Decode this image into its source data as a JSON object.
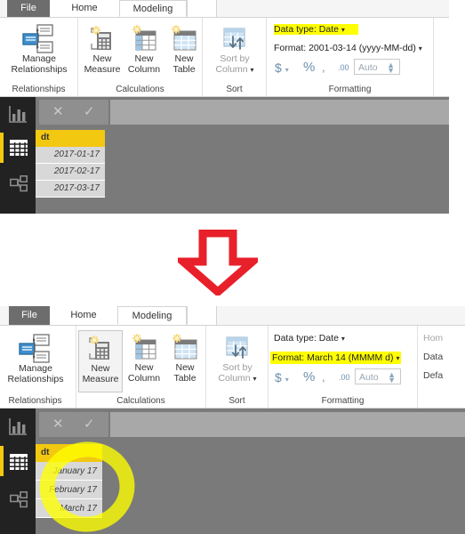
{
  "meta": {
    "accent_yellow": "#f2c811",
    "highlight_yellow": "#ffff00",
    "arrow_red": "#e8202a",
    "workspace_gray": "#7a7a7a",
    "rail_dark": "#222222"
  },
  "screenshots": [
    {
      "id": "before",
      "tabs": [
        {
          "label": "File",
          "state": "file"
        },
        {
          "label": "Home",
          "state": "normal"
        },
        {
          "label": "Modeling",
          "state": "active"
        }
      ],
      "ribbon": {
        "groups": [
          {
            "name": "Relationships",
            "label": "Relationships",
            "buttons": [
              {
                "label_line1": "Manage",
                "label_line2": "Relationships",
                "icon": "manage-relationships-icon",
                "framed": false
              }
            ]
          },
          {
            "name": "Calculations",
            "label": "Calculations",
            "buttons": [
              {
                "label_line1": "New",
                "label_line2": "Measure",
                "icon": "new-measure-icon",
                "framed": false
              },
              {
                "label_line1": "New",
                "label_line2": "Column",
                "icon": "new-column-icon",
                "framed": false
              },
              {
                "label_line1": "New",
                "label_line2": "Table",
                "icon": "new-table-icon",
                "framed": false
              }
            ]
          },
          {
            "name": "Sort",
            "label": "Sort",
            "buttons": [
              {
                "label_line1": "Sort by",
                "label_line2": "Column",
                "icon": "sort-by-column-icon",
                "framed": false,
                "disabled": true,
                "caret": true
              }
            ]
          },
          {
            "name": "Formatting",
            "label": "Formatting",
            "data_type_label": "Data type: Date",
            "data_type_highlighted": true,
            "format_label": "Format: 2001-03-14 (yyyy-MM-dd)",
            "format_highlighted": false,
            "currency_label": "$",
            "percent_label": "%",
            "comma_label": ",",
            "decimal_label": ".00",
            "decimal_places_value": "Auto"
          }
        ],
        "right_clipped": [
          "",
          "",
          ""
        ]
      },
      "workspace": {
        "nav_items": [
          {
            "name": "report-view",
            "icon": "bar-chart-icon",
            "selected": false
          },
          {
            "name": "data-view",
            "icon": "table-grid-icon",
            "selected": true
          },
          {
            "name": "model-view",
            "icon": "relationship-model-icon",
            "selected": false
          }
        ],
        "formula_bar": {
          "cancel_icon": "cancel-x-icon",
          "accept_icon": "accept-check-icon",
          "value": ""
        },
        "table": {
          "column_header": "dt",
          "rows": [
            "2017-01-17",
            "2017-02-17",
            "2017-03-17"
          ]
        }
      }
    },
    {
      "id": "after",
      "tabs": [
        {
          "label": "File",
          "state": "file"
        },
        {
          "label": "Home",
          "state": "normal"
        },
        {
          "label": "Modeling",
          "state": "active"
        }
      ],
      "ribbon": {
        "groups": [
          {
            "name": "Relationships",
            "label": "Relationships",
            "buttons": [
              {
                "label_line1": "Manage",
                "label_line2": "Relationships",
                "icon": "manage-relationships-icon",
                "framed": false
              }
            ]
          },
          {
            "name": "Calculations",
            "label": "Calculations",
            "buttons": [
              {
                "label_line1": "New",
                "label_line2": "Measure",
                "icon": "new-measure-icon",
                "framed": true
              },
              {
                "label_line1": "New",
                "label_line2": "Column",
                "icon": "new-column-icon",
                "framed": false
              },
              {
                "label_line1": "New",
                "label_line2": "Table",
                "icon": "new-table-icon",
                "framed": false
              }
            ]
          },
          {
            "name": "Sort",
            "label": "Sort",
            "buttons": [
              {
                "label_line1": "Sort by",
                "label_line2": "Column",
                "icon": "sort-by-column-icon",
                "framed": false,
                "disabled": true,
                "caret": true
              }
            ]
          },
          {
            "name": "Formatting",
            "label": "Formatting",
            "data_type_label": "Data type: Date",
            "data_type_highlighted": false,
            "format_label": "Format: March 14 (MMMM d)",
            "format_highlighted": true,
            "currency_label": "$",
            "percent_label": "%",
            "comma_label": ",",
            "decimal_label": ".00",
            "decimal_places_value": "Auto"
          }
        ],
        "right_clipped": [
          "Hom",
          "Data",
          "Defa"
        ]
      },
      "workspace": {
        "nav_items": [
          {
            "name": "report-view",
            "icon": "bar-chart-icon",
            "selected": false
          },
          {
            "name": "data-view",
            "icon": "table-grid-icon",
            "selected": true
          },
          {
            "name": "model-view",
            "icon": "relationship-model-icon",
            "selected": false
          }
        ],
        "formula_bar": {
          "cancel_icon": "cancel-x-icon",
          "accept_icon": "accept-check-icon",
          "value": ""
        },
        "table": {
          "column_header": "dt",
          "rows": [
            "January 17",
            "February 17",
            "March 17"
          ]
        }
      }
    }
  ],
  "annotations": {
    "arrow": {
      "name": "down-arrow-annotation",
      "direction": "down",
      "color": "#e8202a"
    },
    "circle": {
      "name": "circle-highlight-annotation",
      "color": "#ffff00"
    }
  }
}
